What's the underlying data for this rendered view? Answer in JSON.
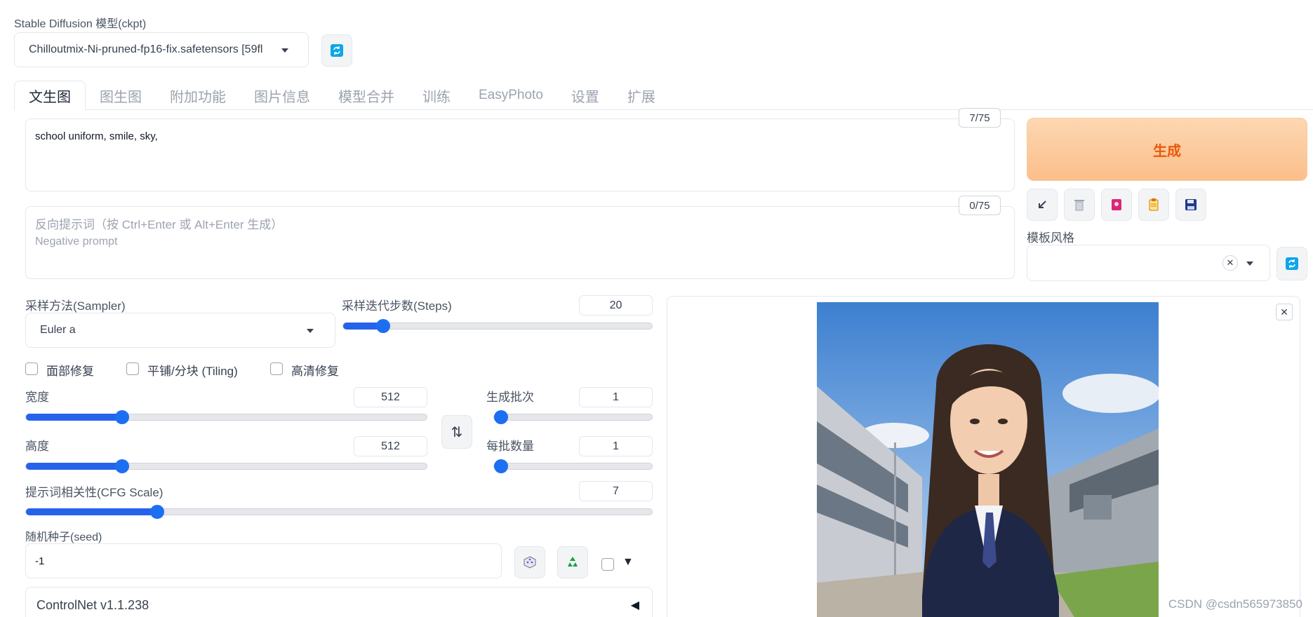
{
  "model": {
    "label": "Stable Diffusion 模型(ckpt)",
    "selected": "Chilloutmix-Ni-pruned-fp16-fix.safetensors [59fl"
  },
  "tabs": [
    "文生图",
    "图生图",
    "附加功能",
    "图片信息",
    "模型合并",
    "训练",
    "EasyPhoto",
    "设置",
    "扩展"
  ],
  "prompt": {
    "value": "school uniform, smile, sky,",
    "token_count": "7/75"
  },
  "negative_prompt": {
    "placeholder_line1": "反向提示词（按 Ctrl+Enter 或 Alt+Enter 生成）",
    "placeholder_line2": "Negative prompt",
    "token_count": "0/75"
  },
  "generate": {
    "label": "生成"
  },
  "tool_buttons": [
    "arrow-down-left-icon",
    "trash-icon",
    "notebook-icon",
    "clipboard-icon",
    "save-icon"
  ],
  "styles": {
    "label": "模板风格",
    "clear": "✕"
  },
  "sampler": {
    "label": "采样方法(Sampler)",
    "value": "Euler a"
  },
  "steps": {
    "label": "采样迭代步数(Steps)",
    "value": "20",
    "fraction": 0.13
  },
  "checkboxes": [
    "面部修复",
    "平铺/分块 (Tiling)",
    "高清修复"
  ],
  "width": {
    "label": "宽度",
    "value": "512",
    "fraction": 0.24
  },
  "height": {
    "label": "高度",
    "value": "512",
    "fraction": 0.24
  },
  "swap_icon": "⇅",
  "batch_count": {
    "label": "生成批次",
    "value": "1",
    "fraction": 0.0
  },
  "batch_size": {
    "label": "每批数量",
    "value": "1",
    "fraction": 0.0
  },
  "cfg": {
    "label": "提示词相关性(CFG Scale)",
    "value": "7",
    "fraction": 0.21
  },
  "seed": {
    "label": "随机种子(seed)",
    "value": "-1",
    "extra_toggle": "▼"
  },
  "controlnet": {
    "label": "ControlNet v1.1.238",
    "toggle": "◀"
  },
  "gallery": {
    "close": "✕"
  },
  "watermark": "CSDN @csdn565973850",
  "colors": {
    "accent": "#2563eb",
    "generate_text": "#ea580c",
    "refresh_icon": "#0ea5e9"
  }
}
